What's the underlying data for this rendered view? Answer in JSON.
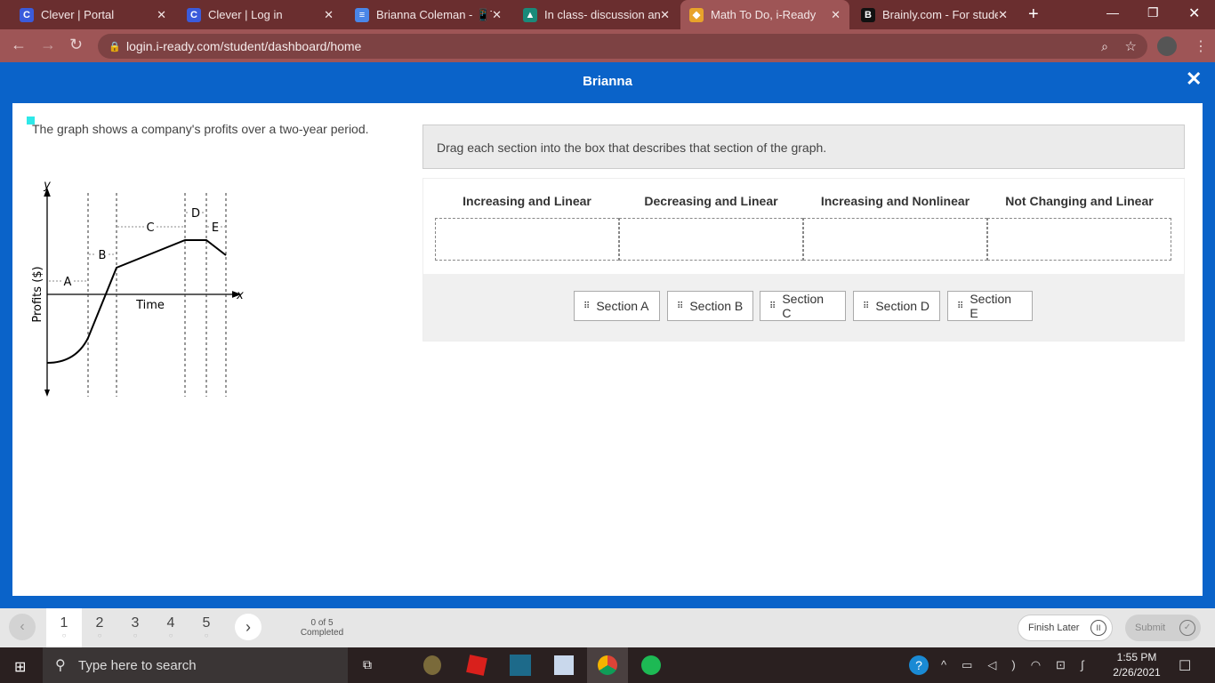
{
  "browser": {
    "tabs": [
      {
        "title": "Clever | Portal",
        "icon": "C"
      },
      {
        "title": "Clever | Log in",
        "icon": "C"
      },
      {
        "title": "Brianna Coleman - 📱T",
        "icon": "≡"
      },
      {
        "title": "In class- discussion and",
        "icon": "▲"
      },
      {
        "title": "Math To Do, i-Ready",
        "icon": "◆"
      },
      {
        "title": "Brainly.com - For studen",
        "icon": "B"
      }
    ],
    "active_tab": 4,
    "url": "login.i-ready.com/student/dashboard/home"
  },
  "header": {
    "title": "Brianna",
    "close": "✕"
  },
  "question": {
    "prompt": "The graph shows a company's profits over a two-year period.",
    "graph": {
      "y_axis": "y",
      "x_axis": "x",
      "ylabel": "Profits ($)",
      "xlabel": "Time",
      "sections": [
        "A",
        "B",
        "C",
        "D",
        "E"
      ]
    }
  },
  "activity": {
    "instructions": "Drag each section into the box that describes that section of the graph.",
    "categories": [
      "Increasing and Linear",
      "Decreasing and Linear",
      "Increasing and Nonlinear",
      "Not Changing and Linear"
    ],
    "chips": [
      "Section A",
      "Section B",
      "Section C",
      "Section D",
      "Section E"
    ]
  },
  "footer": {
    "questions": [
      "1",
      "2",
      "3",
      "4",
      "5"
    ],
    "progress": "0 of 5",
    "progress_label": "Completed",
    "finish_later": "Finish Later",
    "submit": "Submit"
  },
  "taskbar": {
    "search_placeholder": "Type here to search",
    "time": "1:55 PM",
    "date": "2/26/2021"
  }
}
